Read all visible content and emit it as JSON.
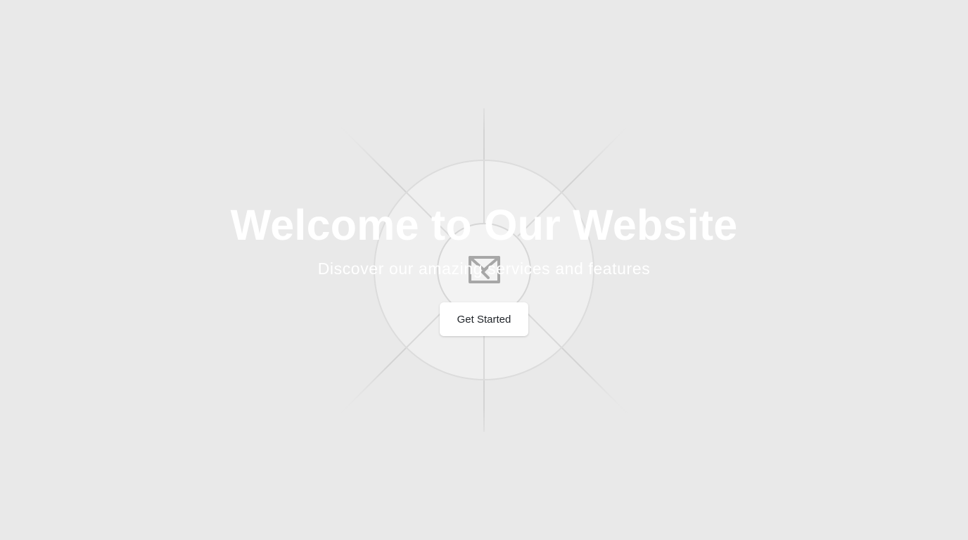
{
  "hero": {
    "title": "Welcome to Our Website",
    "subtitle": "Discover our amazing services and features",
    "cta_label": "Get Started",
    "background_image_icon": "broken-image-icon"
  },
  "colors": {
    "background": "#e9e9e9",
    "text": "#ffffff",
    "button_background": "#ffffff",
    "button_text": "#1f2328",
    "placeholder_lines": "#d4d4d4"
  }
}
